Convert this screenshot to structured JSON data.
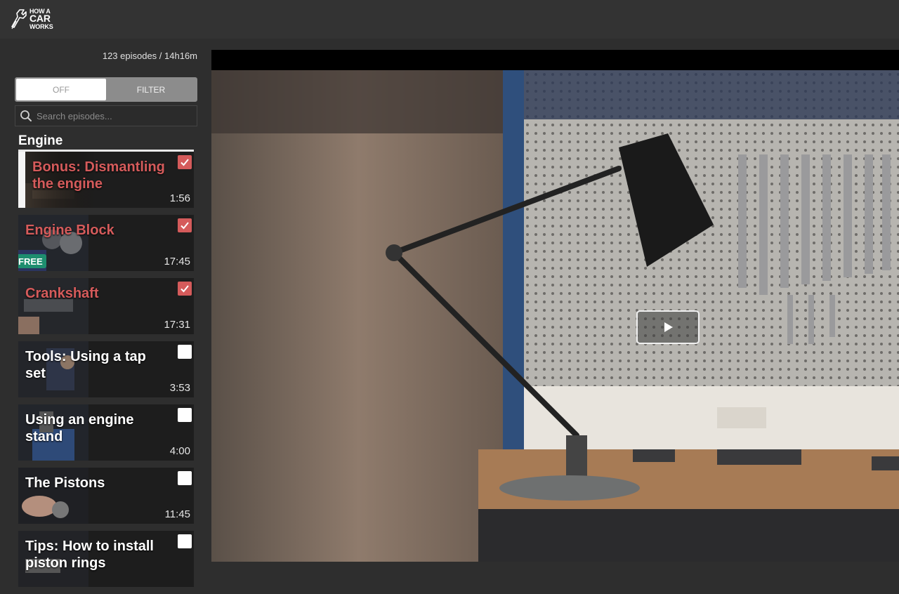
{
  "brand": {
    "line1": "HOW A",
    "line2": "CAR",
    "line3": "WORKS"
  },
  "sidebar": {
    "episode_count": "123 episodes / 14h16m",
    "toggle": {
      "off_label": "OFF",
      "filter_label": "FILTER"
    },
    "search": {
      "placeholder": "Search episodes..."
    },
    "section_title": "Engine",
    "episodes": [
      {
        "title": "Bonus: Dismantling the engine",
        "duration": "1:56",
        "watched": true,
        "active": true,
        "free": false
      },
      {
        "title": "Engine Block",
        "duration": "17:45",
        "watched": true,
        "active": false,
        "free": true,
        "badge": "FREE"
      },
      {
        "title": "Crankshaft",
        "duration": "17:31",
        "watched": true,
        "active": false,
        "free": false
      },
      {
        "title": "Tools: Using a tap set",
        "duration": "3:53",
        "watched": false,
        "active": false,
        "free": false
      },
      {
        "title": "Using an engine stand",
        "duration": "4:00",
        "watched": false,
        "active": false,
        "free": false
      },
      {
        "title": "The Pistons",
        "duration": "11:45",
        "watched": false,
        "active": false,
        "free": false
      },
      {
        "title": "Tips: How to install piston rings",
        "duration": "",
        "watched": false,
        "active": false,
        "free": false
      }
    ]
  },
  "colors": {
    "watched": "#d55b5b",
    "free_badge": "#1e8e6f",
    "background": "#2e2e2e",
    "topbar": "#333333"
  },
  "icons": {
    "logo": "wrench-logo-icon",
    "search": "search-icon",
    "play": "play-icon",
    "check": "checkmark-icon"
  }
}
